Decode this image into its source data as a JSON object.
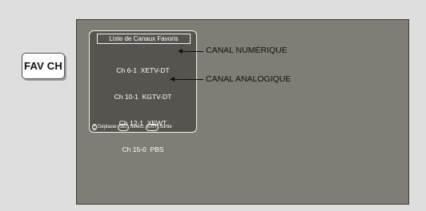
{
  "remote_button": {
    "label": "FAV CH"
  },
  "favorites_menu": {
    "title": "Liste de Canaux Favoris",
    "channels": [
      "Ch 6-1  XETV-DT",
      "Ch 10-1  KGTV-DT",
      "Ch 12-1  XEWT",
      "Ch 15-0  PBS"
    ],
    "footer": {
      "move_label": "Déplacer",
      "select_key": "SEL",
      "select_label": "Sélect.",
      "exit_key": "EXIT",
      "exit_label": "Sortie"
    }
  },
  "callouts": {
    "digital": "CANAL NUMÉRIQUE",
    "analog": "CANAL ANALOGIQUE"
  },
  "colors": {
    "page_background": "#dedede",
    "screen_background": "#7f7d76",
    "panel_background": "#56544f"
  }
}
